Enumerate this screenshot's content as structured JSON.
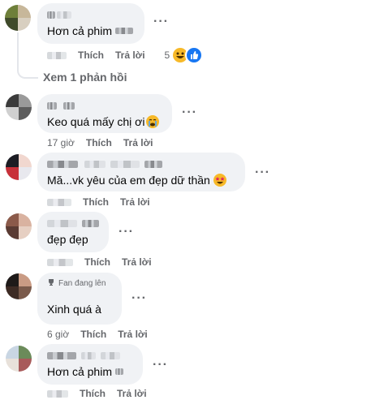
{
  "comments": [
    {
      "text": "Hơn cả phim",
      "time": "",
      "like": "Thích",
      "reply": "Trả lời",
      "reaction_count": "5",
      "reply_link": "Xem 1 phản hồi",
      "avatar_colors": [
        "#6e7f3a",
        "#c7b79a",
        "#3f4a2a",
        "#d8cfc0"
      ]
    },
    {
      "text": "Keo quá mấy chị ơi",
      "emoji": "crying-face",
      "time": "17 giờ",
      "like": "Thích",
      "reply": "Trả lời",
      "avatar_colors": [
        "#3b3b3b",
        "#9a9a9a",
        "#d0d0d0",
        "#5d5d5d"
      ]
    },
    {
      "text": "Mă...vk yêu của em đẹp dữ thần",
      "emoji": "star-struck-face",
      "time": "",
      "like": "Thích",
      "reply": "Trả lời",
      "avatar_colors": [
        "#1d1d24",
        "#f1d7cf",
        "#c7313a",
        "#e8e8ee"
      ]
    },
    {
      "text": "đẹp đẹp",
      "time": "",
      "like": "Thích",
      "reply": "Trả lời",
      "avatar_colors": [
        "#8b5a4a",
        "#d9b2a0",
        "#5a3b33",
        "#e6cfc2"
      ]
    },
    {
      "badge": "Fan đang lên",
      "text": "Xinh quá à",
      "time": "6 giờ",
      "like": "Thích",
      "reply": "Trả lời",
      "avatar_colors": [
        "#1e1a19",
        "#c99b84",
        "#3d2b24",
        "#7a5a4b"
      ]
    },
    {
      "text": "Hơn cả phim",
      "time": "",
      "like": "Thích",
      "reply": "Trả lời",
      "avatar_colors": [
        "#c9d6e3",
        "#6b8b5a",
        "#e8e1da",
        "#a85a5a"
      ]
    }
  ],
  "more_icon": "three-dots-icon",
  "colors": {
    "bubble": "#f0f2f5",
    "meta": "#65676b",
    "haha": "#f7b928",
    "like": "#1877f2"
  }
}
